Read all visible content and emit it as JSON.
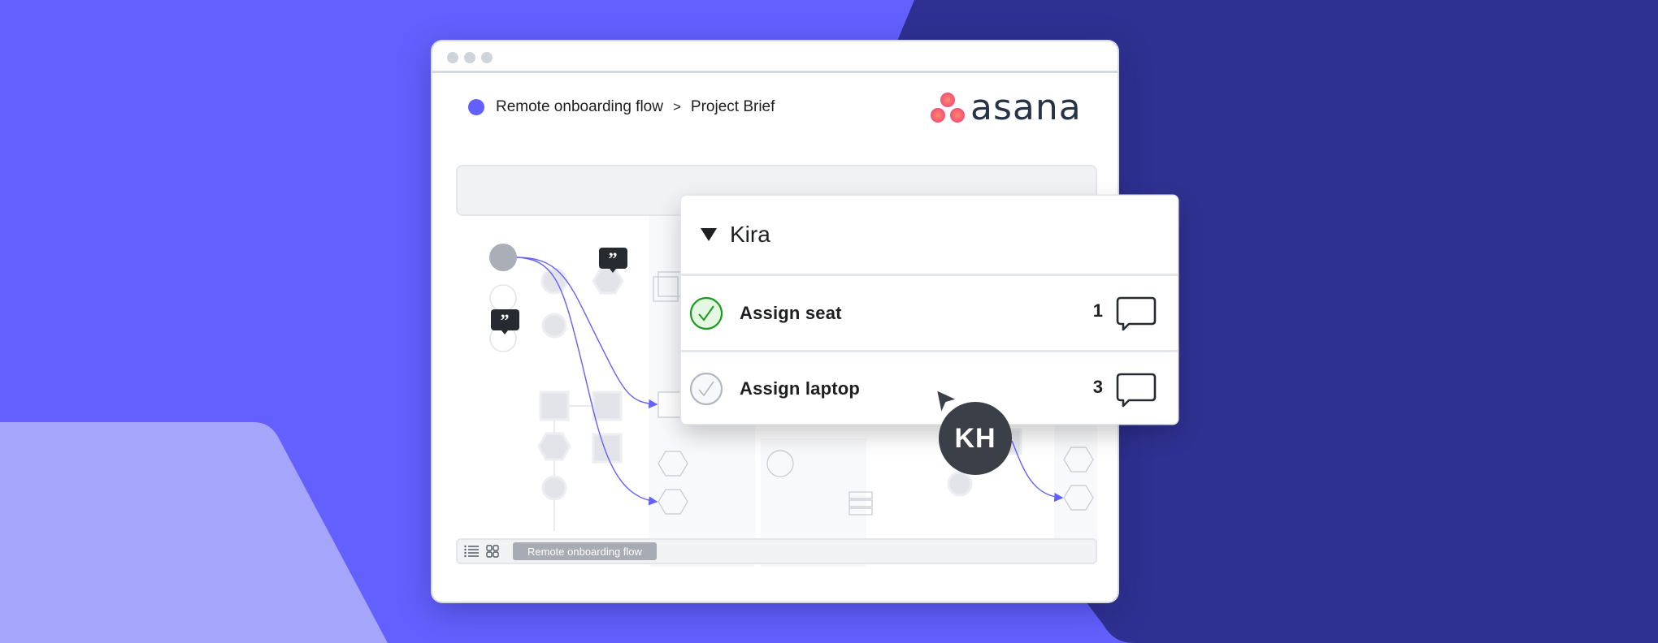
{
  "colors": {
    "background": "#6360ff",
    "background_dark": "#2f3192",
    "background_light": "#a5a5fc",
    "accent": "#6360ff",
    "connector": "#6360ff",
    "check_done": "#1d9a1d",
    "check_done_fill": "#e3f7e3",
    "check_pending": "#b2b7c0",
    "avatar_bg": "#3b3f48",
    "logo_text": "#273347"
  },
  "window": {
    "breadcrumb": {
      "project": "Remote onboarding flow",
      "separator": ">",
      "page": "Project Brief"
    },
    "logo": {
      "name": "asana",
      "icon": "asana-dots-icon"
    }
  },
  "toolbar": {
    "list_view_icon": "list-icon",
    "grid_view_icon": "grid-icon",
    "active_tab": "Remote onboarding flow"
  },
  "task_card": {
    "assignee": "Kira",
    "expand_icon": "caret-down-icon",
    "tasks": [
      {
        "label": "Assign seat",
        "completed": true,
        "comment_count": "1",
        "icon": "comment-icon"
      },
      {
        "label": "Assign laptop",
        "completed": false,
        "comment_count": "3",
        "icon": "comment-icon"
      }
    ]
  },
  "collaborator": {
    "initials": "KH",
    "cursor_icon": "cursor-arrow-icon"
  },
  "diagram": {
    "comment_bubble_icon": "quote-bubble-icon"
  }
}
